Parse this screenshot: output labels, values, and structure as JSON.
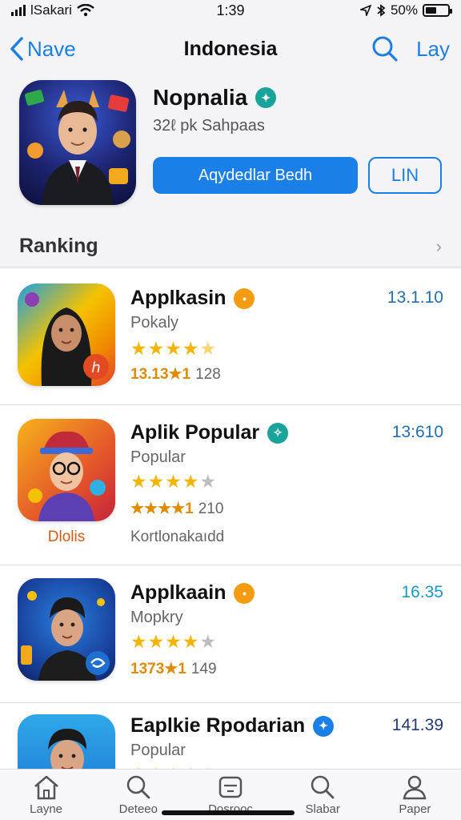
{
  "status_bar": {
    "carrier": "lSakari",
    "time": "1:39",
    "battery": "50%",
    "battery_level": 0.5
  },
  "nav": {
    "back_label": "Nave",
    "title": "Indonesia",
    "right_label": "Lay"
  },
  "featured": {
    "name": "Nopnalia",
    "subtitle": "32ℓ pk Sahpaas",
    "badge_color": "#1aa39a",
    "primary_button": "Aqydedlar Bedh",
    "secondary_button": "LIN"
  },
  "ranking": {
    "title": "Ranking"
  },
  "apps": [
    {
      "name": "Applkasin",
      "badge_color": "#f39c12",
      "category": "Pokaly",
      "stars": 4.5,
      "score": "13.13★1",
      "count": "128",
      "price": "13.1.10",
      "price_color": "#1f6fb8"
    },
    {
      "name": "Aplik Popular",
      "badge_color": "#1aa39a",
      "category": "Popular",
      "stars": 4.0,
      "score": "★★★★1",
      "count": "210",
      "price": "13:610",
      "price_color": "#1f6fb8",
      "icon_caption": "Dlolis",
      "extra": "Kortlonakaıdd"
    },
    {
      "name": "Applkaain",
      "badge_color": "#f39c12",
      "category": "Mopkry",
      "stars": 4.0,
      "score": "1373★1",
      "count": "149",
      "price": "16.35",
      "price_color": "#1a98c9"
    },
    {
      "name": "Eaplkie Rpodarian",
      "badge_color": "#1a7fe6",
      "category": "Popular",
      "stars": 4.0,
      "price": "141.39",
      "price_color": "#233a7a"
    }
  ],
  "tabs": [
    {
      "label": "Layne",
      "icon": "house-icon"
    },
    {
      "label": "Deteeo",
      "icon": "search-icon"
    },
    {
      "label": "Dosrooc",
      "icon": "stack-icon"
    },
    {
      "label": "Slabar",
      "icon": "search-icon"
    },
    {
      "label": "Paper",
      "icon": "person-icon"
    }
  ],
  "colors": {
    "accent": "#1a7fe6",
    "star": "#f5b400"
  }
}
